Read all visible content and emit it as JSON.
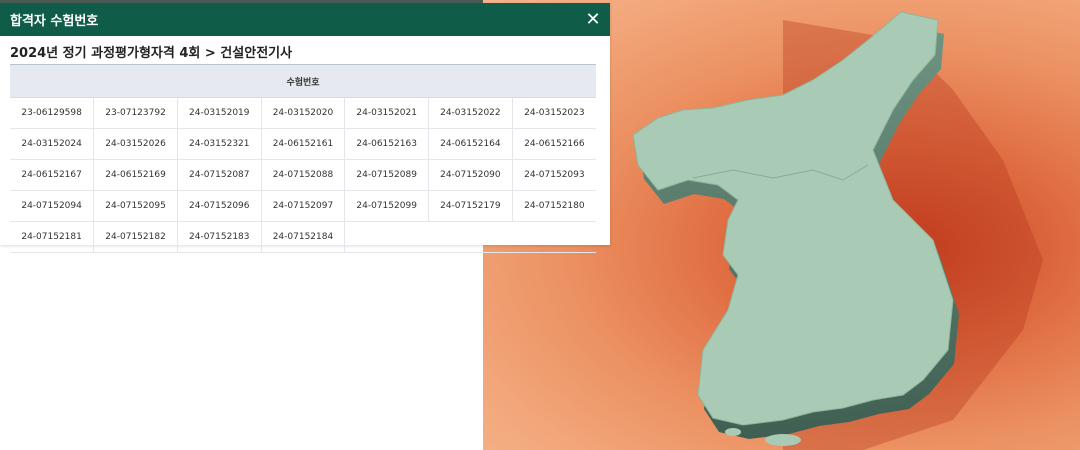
{
  "modal": {
    "title": "합격자 수험번호",
    "subtitle": "2024년 정기 과정평가형자격 4회 > 건설안전기사",
    "table_header": "수험번호",
    "rows": [
      [
        "23-06129598",
        "23-07123792",
        "24-03152019",
        "24-03152020",
        "24-03152021",
        "24-03152022",
        "24-03152023"
      ],
      [
        "24-03152024",
        "24-03152026",
        "24-03152321",
        "24-06152161",
        "24-06152163",
        "24-06152164",
        "24-06152166"
      ],
      [
        "24-06152167",
        "24-06152169",
        "24-07152087",
        "24-07152088",
        "24-07152089",
        "24-07152090",
        "24-07152093"
      ],
      [
        "24-07152094",
        "24-07152095",
        "24-07152096",
        "24-07152097",
        "24-07152099",
        "24-07152179",
        "24-07152180"
      ],
      [
        "24-07152181",
        "24-07152182",
        "24-07152183",
        "24-07152184"
      ]
    ]
  },
  "colors": {
    "header_bg": "#0f5c48",
    "table_header_bg": "#e6eaf0",
    "map_land": "#a9cbb6",
    "map_bg": "#eb8f60"
  },
  "icons": {
    "close": "close-icon",
    "map": "korea-map-illustration"
  }
}
